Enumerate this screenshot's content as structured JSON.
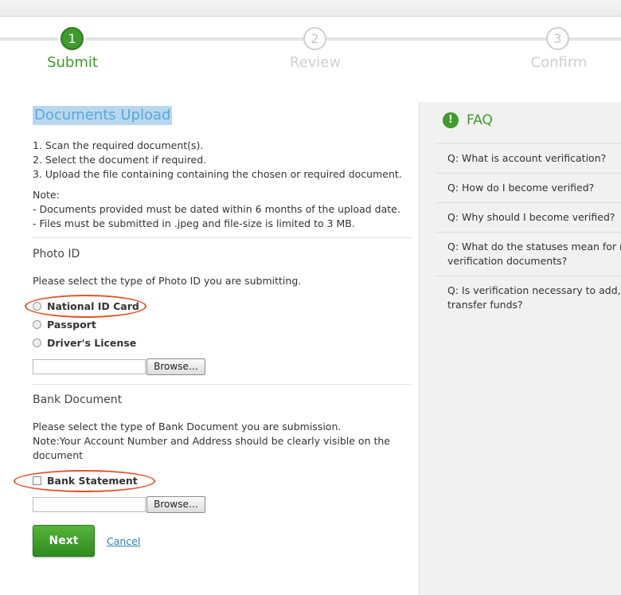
{
  "steps": [
    {
      "number": "1",
      "label": "Submit"
    },
    {
      "number": "2",
      "label": "Review"
    },
    {
      "number": "3",
      "label": "Confirm"
    }
  ],
  "main": {
    "title": "Documents Upload",
    "instructions": [
      "1.  Scan the required document(s).",
      "2.  Select the document if required.",
      "3.  Upload the file containing containing the chosen or required document."
    ],
    "note_heading": "Note:",
    "note_lines": [
      "- Documents provided must be dated within 6 months of the upload date.",
      "- Files must be submitted in .jpeg and file-size is limited to 3 MB."
    ],
    "photo_id": {
      "title": "Photo ID",
      "prompt": "Please select the type of Photo ID you are submitting.",
      "options": [
        "National ID Card",
        "Passport",
        "Driver's License"
      ],
      "browse_label": "Browse…"
    },
    "bank": {
      "title": "Bank Document",
      "prompt_lines": [
        "Please select the type of Bank Document you are submission.",
        "Note:Your Account Number and Address should be clearly visible on the",
        "document"
      ],
      "option": "Bank Statement",
      "browse_label": "Browse…"
    },
    "next_label": "Next",
    "cancel_label": "Cancel"
  },
  "faq": {
    "title": "FAQ",
    "icon": "!",
    "items": [
      [
        "Q: What is account verification?"
      ],
      [
        "Q: How do I become verified?"
      ],
      [
        "Q: Why should I become verified?"
      ],
      [
        "Q: What do the statuses mean for my",
        "verification documents?"
      ],
      [
        "Q: Is verification necessary to add, w",
        "transfer funds?"
      ]
    ]
  },
  "colors": {
    "accent": "#3f9b2b",
    "annotation": "#e2542b",
    "link": "#2a7fb0"
  }
}
